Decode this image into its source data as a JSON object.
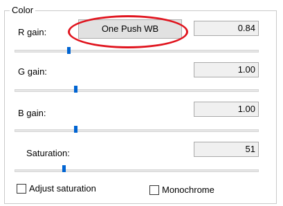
{
  "group": {
    "title": "Color"
  },
  "r_gain": {
    "label": "R gain:",
    "value": "0.84",
    "slider_fraction": 0.22
  },
  "g_gain": {
    "label": "G gain:",
    "value": "1.00",
    "slider_fraction": 0.25
  },
  "b_gain": {
    "label": "B gain:",
    "value": "1.00",
    "slider_fraction": 0.25
  },
  "saturation": {
    "label": "Saturation:",
    "value": "51",
    "slider_fraction": 0.2
  },
  "one_push_wb": {
    "label": "One Push WB"
  },
  "checkboxes": {
    "adjust_saturation": {
      "label": "Adjust saturation",
      "checked": false
    },
    "monochrome": {
      "label": "Monochrome",
      "checked": false
    }
  },
  "highlight_color": "#e0141e",
  "slider_thumb_color": "#0064d2"
}
